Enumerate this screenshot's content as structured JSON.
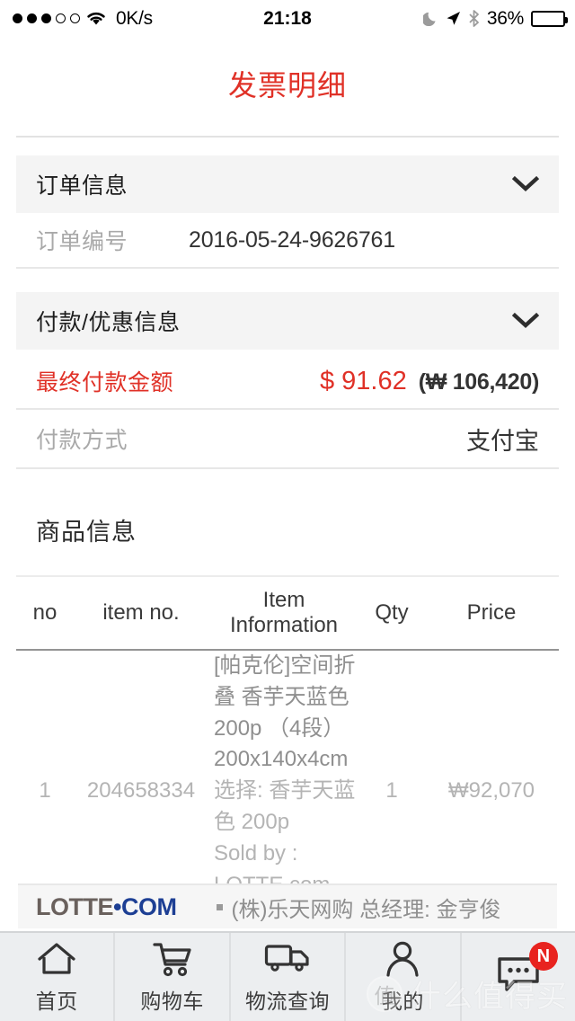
{
  "statusbar": {
    "signal_filled": 3,
    "signal_empty": 2,
    "wifi_icon": "wifi-icon",
    "network_speed": "0K/s",
    "time": "21:18",
    "moon_icon": "moon-icon",
    "location_icon": "location-arrow-icon",
    "bluetooth_icon": "bluetooth-icon",
    "battery_percent": "36%",
    "battery_level": 36
  },
  "page": {
    "title": "发票明细",
    "title_color": "#e03127"
  },
  "sections": {
    "order": {
      "header": "订单信息",
      "chevron_icon": "chevron-down-icon",
      "rows": [
        {
          "key": "订单编号",
          "value": "2016-05-24-9626761"
        }
      ]
    },
    "payment": {
      "header": "付款/优惠信息",
      "chevron_icon": "chevron-down-icon",
      "final_label": "最终付款金额",
      "final_amount": "$ 91.62",
      "final_amount_sub": "(₩ 106,420)",
      "method_label": "付款方式",
      "method_value": "支付宝"
    },
    "product": {
      "title": "商品信息",
      "columns": [
        "no",
        "item no.",
        "Item Information",
        "Qty",
        "Price"
      ],
      "rows": [
        {
          "no": "1",
          "item_no": "204658334",
          "name": "[帕克伦]空间折叠 香芋天蓝色 200p （4段）200x140x4cm",
          "option": "选择: 香芋天蓝色 200p",
          "sold_by": "Sold by : LOTTE.com, Inc",
          "qty": "1",
          "price": "₩92,070"
        }
      ]
    }
  },
  "footer": {
    "logo_primary": "LOTTE",
    "logo_secondary": "•COM",
    "bullet_icon": "square-bullet-icon",
    "text": "(株)乐天网购 总经理: 金亨俊"
  },
  "nav": {
    "items": [
      {
        "label": "首页",
        "icon": "home-icon",
        "badge": ""
      },
      {
        "label": "购物车",
        "icon": "shopping-cart-icon",
        "badge": ""
      },
      {
        "label": "物流查询",
        "icon": "truck-icon",
        "badge": ""
      },
      {
        "label": "我的",
        "icon": "user-icon",
        "badge": ""
      },
      {
        "label": "",
        "icon": "chat-bubble-icon",
        "badge": "N"
      }
    ]
  },
  "watermark": {
    "logo_char": "值",
    "text": "什么值得买"
  },
  "colors": {
    "accent_red": "#e03127",
    "badge_red": "#e8231f",
    "section_bg": "#f4f4f4",
    "nav_bg": "#eceef0"
  }
}
